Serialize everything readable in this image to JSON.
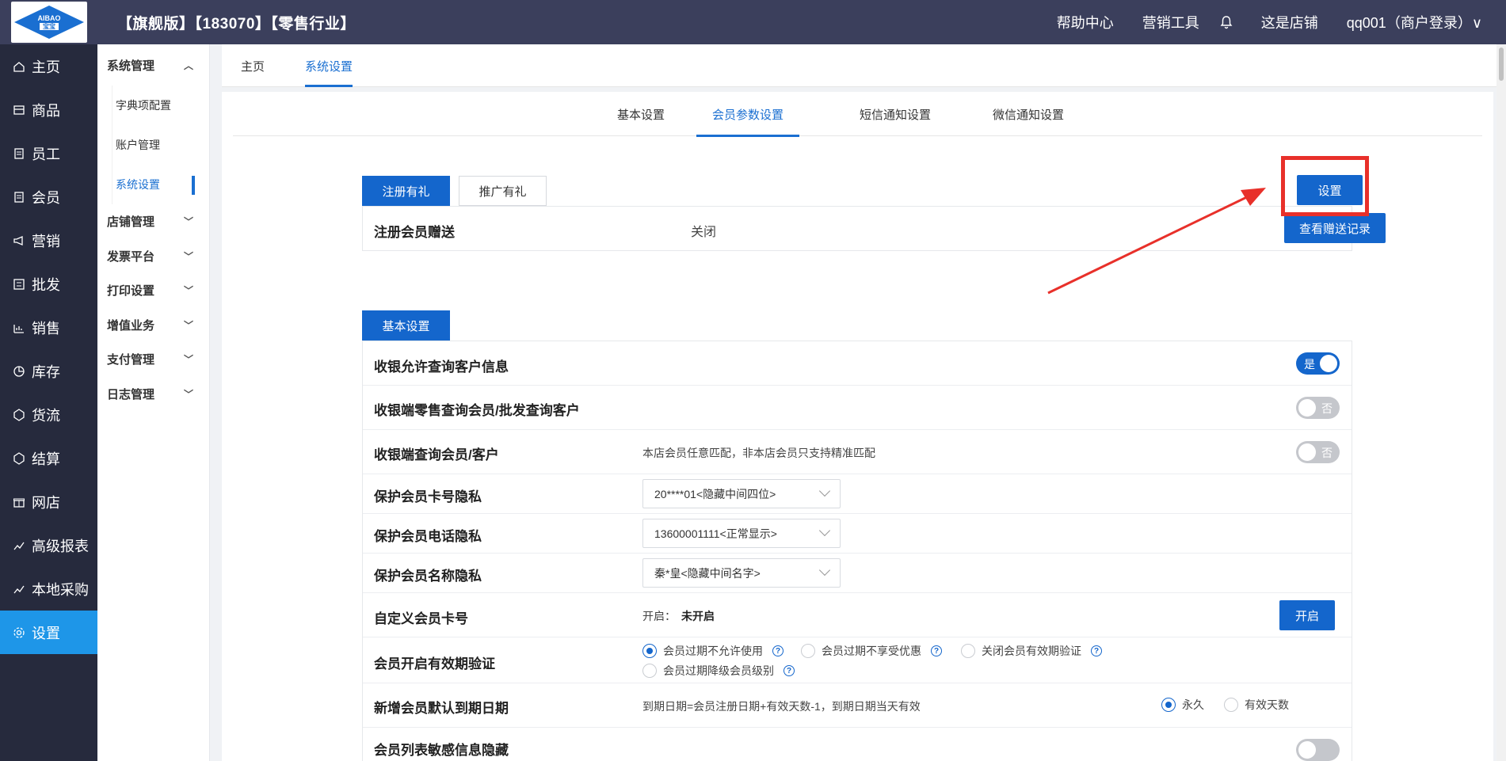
{
  "topbar": {
    "logo_text": "AIBAO",
    "logo_sub": "宝宝",
    "store_title": "【旗舰版】【183070】【零售行业】",
    "help": "帮助中心",
    "marketing_tools": "营销工具",
    "shop": "这是店铺",
    "user": "qq001（商户登录）∨"
  },
  "leftnav": [
    {
      "label": "主页",
      "icon": "home-icon"
    },
    {
      "label": "商品",
      "icon": "goods-icon"
    },
    {
      "label": "员工",
      "icon": "staff-icon"
    },
    {
      "label": "会员",
      "icon": "member-icon"
    },
    {
      "label": "营销",
      "icon": "megaphone-icon"
    },
    {
      "label": "批发",
      "icon": "wholesale-icon"
    },
    {
      "label": "销售",
      "icon": "sales-icon"
    },
    {
      "label": "库存",
      "icon": "stock-icon"
    },
    {
      "label": "货流",
      "icon": "flow-icon"
    },
    {
      "label": "结算",
      "icon": "settle-icon"
    },
    {
      "label": "网店",
      "icon": "gift-icon"
    },
    {
      "label": "高级报表",
      "icon": "report-icon"
    },
    {
      "label": "本地采购",
      "icon": "purchase-icon"
    },
    {
      "label": "设置",
      "icon": "gear-icon"
    }
  ],
  "subnav": {
    "system_group": "系统管理",
    "system_items": [
      "字典项配置",
      "账户管理",
      "系统设置"
    ],
    "groups": [
      "店铺管理",
      "发票平台",
      "打印设置",
      "增值业务",
      "支付管理",
      "日志管理"
    ]
  },
  "tabs": {
    "home": "主页",
    "system": "系统设置"
  },
  "subtabs": [
    "基本设置",
    "会员参数设置",
    "短信通知设置",
    "微信通知设置"
  ],
  "gift": {
    "tab_register": "注册有礼",
    "tab_promo": "推广有礼",
    "settings_button": "设置",
    "row_label": "注册会员赠送",
    "row_value": "关闭",
    "view_records": "查看赠送记录"
  },
  "basic": {
    "tab": "基本设置",
    "rows": {
      "r1_label": "收银允许查询客户信息",
      "r1_toggle": "是",
      "r2_label": "收银端零售查询会员/批发查询客户",
      "r2_toggle": "否",
      "r3_label": "收银端查询会员/客户",
      "r3_desc": "本店会员任意匹配，非本店会员只支持精准匹配",
      "r3_toggle": "否",
      "r4_label": "保护会员卡号隐私",
      "r4_select": "20****01<隐藏中间四位>",
      "r5_label": "保护会员电话隐私",
      "r5_select": "13600001111<正常显示>",
      "r6_label": "保护会员名称隐私",
      "r6_select": "秦*皇<隐藏中间名字>",
      "r7_label": "自定义会员卡号",
      "r7_prefix": "开启：",
      "r7_status": "未开启",
      "r7_button": "开启",
      "r8_label": "会员开启有效期验证",
      "r8_opt1": "会员过期不允许使用",
      "r8_opt2": "会员过期不享受优惠",
      "r8_opt3": "关闭会员有效期验证",
      "r8_opt4": "会员过期降级会员级别",
      "r9_label": "新增会员默认到期日期",
      "r9_desc": "到期日期=会员注册日期+有效天数-1，到期日期当天有效",
      "r9_opt1": "永久",
      "r9_opt2": "有效天数",
      "r10_label": "会员列表敏感信息隐藏"
    }
  },
  "colors": {
    "primary": "#1466cc",
    "topbar": "#3b3f5c",
    "sidebar": "#262a3d",
    "active_nav": "#1e96e8",
    "annotation": "#e8302a"
  }
}
